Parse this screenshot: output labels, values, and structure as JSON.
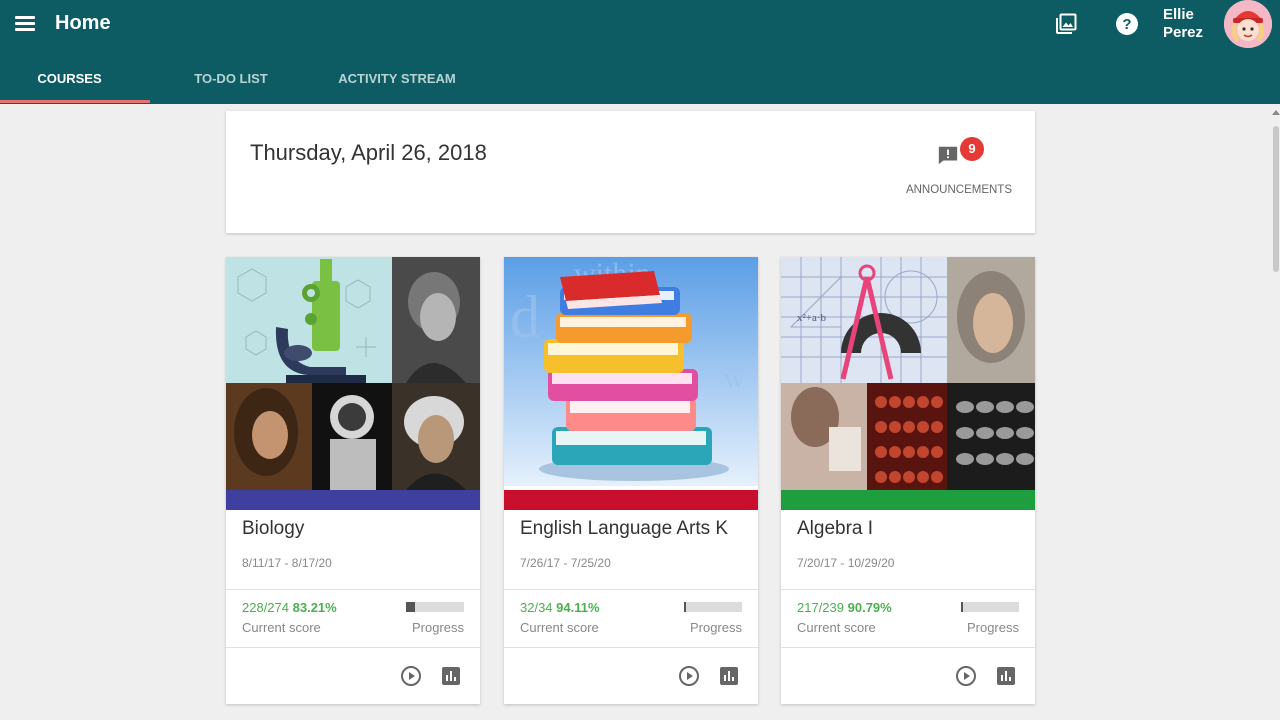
{
  "header": {
    "title": "Home",
    "user_first": "Ellie",
    "user_last": "Perez",
    "tabs": [
      {
        "label": "COURSES",
        "active": true
      },
      {
        "label": "TO-DO LIST",
        "active": false
      },
      {
        "label": "ACTIVITY STREAM",
        "active": false
      }
    ],
    "icons": [
      "menu-icon",
      "gallery-icon",
      "help-icon",
      "avatar"
    ]
  },
  "date_card": {
    "date": "Thursday, April 26, 2018",
    "announcements_label": "ANNOUNCEMENTS",
    "announcements_count": "9"
  },
  "courses": [
    {
      "name": "Biology",
      "dates": "8/11/17 - 8/17/20",
      "points": "228/274",
      "percent": "83.21%",
      "score_label": "Current score",
      "progress_label": "Progress",
      "progress": 0.15,
      "color": "#3f3f9f"
    },
    {
      "name": "English Language Arts K",
      "dates": "7/26/17 - 7/25/20",
      "points": "32/34",
      "percent": "94.11%",
      "score_label": "Current score",
      "progress_label": "Progress",
      "progress": 0.03,
      "color": "#c8102e"
    },
    {
      "name": "Algebra I",
      "dates": "7/20/17 - 10/29/20",
      "points": "217/239",
      "percent": "90.79%",
      "score_label": "Current score",
      "progress_label": "Progress",
      "progress": 0.03,
      "color": "#1e9e3e"
    }
  ],
  "colors": {
    "appbar": "#0d5c63",
    "tab_indicator": "#e57373",
    "score_green": "#4caf50",
    "badge_red": "#e53935"
  }
}
